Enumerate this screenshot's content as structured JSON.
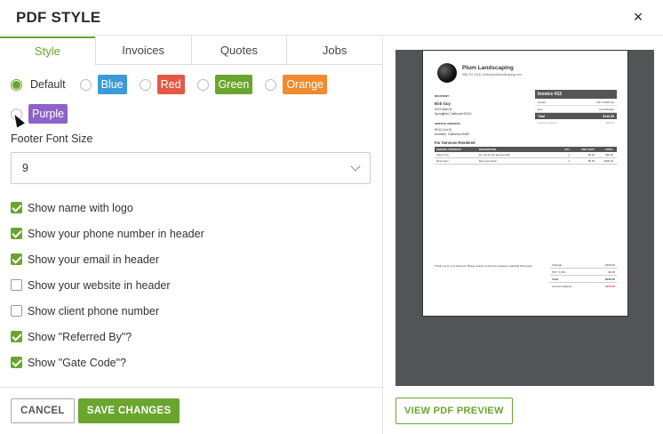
{
  "dialog": {
    "title": "PDF STYLE",
    "close_label": "×"
  },
  "tabs": [
    "Style",
    "Invoices",
    "Quotes",
    "Jobs"
  ],
  "active_tab": "Style",
  "colors": {
    "options": [
      {
        "label": "Default",
        "color": "",
        "checked": true
      },
      {
        "label": "Blue",
        "color": "#3b9ad9",
        "checked": false
      },
      {
        "label": "Red",
        "color": "#e25a45",
        "checked": false
      },
      {
        "label": "Green",
        "color": "#6aa52d",
        "checked": false
      },
      {
        "label": "Orange",
        "color": "#f08a2e",
        "checked": false
      },
      {
        "label": "Purple",
        "color": "#8e62c8",
        "checked": false
      }
    ]
  },
  "footer_font": {
    "label": "Footer Font Size",
    "value": "9"
  },
  "checkboxes": [
    {
      "label": "Show name with logo",
      "checked": true
    },
    {
      "label": "Show your phone number in header",
      "checked": true
    },
    {
      "label": "Show your email in header",
      "checked": true
    },
    {
      "label": "Show your website in header",
      "checked": false
    },
    {
      "label": "Show client phone number",
      "checked": false
    },
    {
      "label": "Show \"Referred By\"?",
      "checked": true
    },
    {
      "label": "Show \"Gate Code\"?",
      "checked": true
    }
  ],
  "buttons": {
    "cancel": "CANCEL",
    "save": "SAVE CHANGES",
    "preview": "VIEW PDF PREVIEW"
  },
  "preview": {
    "company": "Plum Landscaping",
    "contact": "555-757-1116 | hello@plumlandscaping.com",
    "recipient_label": "RECIPIENT:",
    "recipient_name": "Bob Guy",
    "recipient_addr1": "9123 Main St",
    "recipient_addr2": "Springfield, California 90210",
    "service_label": "SERVICE ADDRESS:",
    "service_addr1": "89 42 2nd St",
    "service_addr2": "Anaheim, California 92489",
    "invoice_title": "Invoice #13",
    "issued_label": "Issued",
    "issued_value": "Feb 6 2018 pst",
    "due_label": "Due",
    "due_value": "Feb 08 days",
    "total_label": "Total",
    "total_value": "$140.50",
    "acc_label": "Account balance",
    "acc_value": "$40.50",
    "services_title": "For Services Rendered",
    "table_headers": [
      "SERVICE / PRODUCT",
      "DESCRIPTION",
      "QTY",
      "UNIT COST",
      "TOTAL"
    ],
    "rows": [
      [
        "Clean Pool",
        "Do and do this all good stuff",
        "1",
        "$0.00",
        "$50.00"
      ],
      [
        "Mow Lawn",
        "More good stuff",
        "2",
        "$0.00",
        "$100.00"
      ]
    ],
    "thanks": "Thank you for your business. Please contact us with any questions regarding this invoice.",
    "summary": [
      [
        "Subtotal",
        "$150.00"
      ],
      [
        "PST (7.0%)",
        "$0.00"
      ],
      [
        "Total",
        "$160.00"
      ],
      [
        "Account balance",
        "$240.00"
      ]
    ]
  }
}
